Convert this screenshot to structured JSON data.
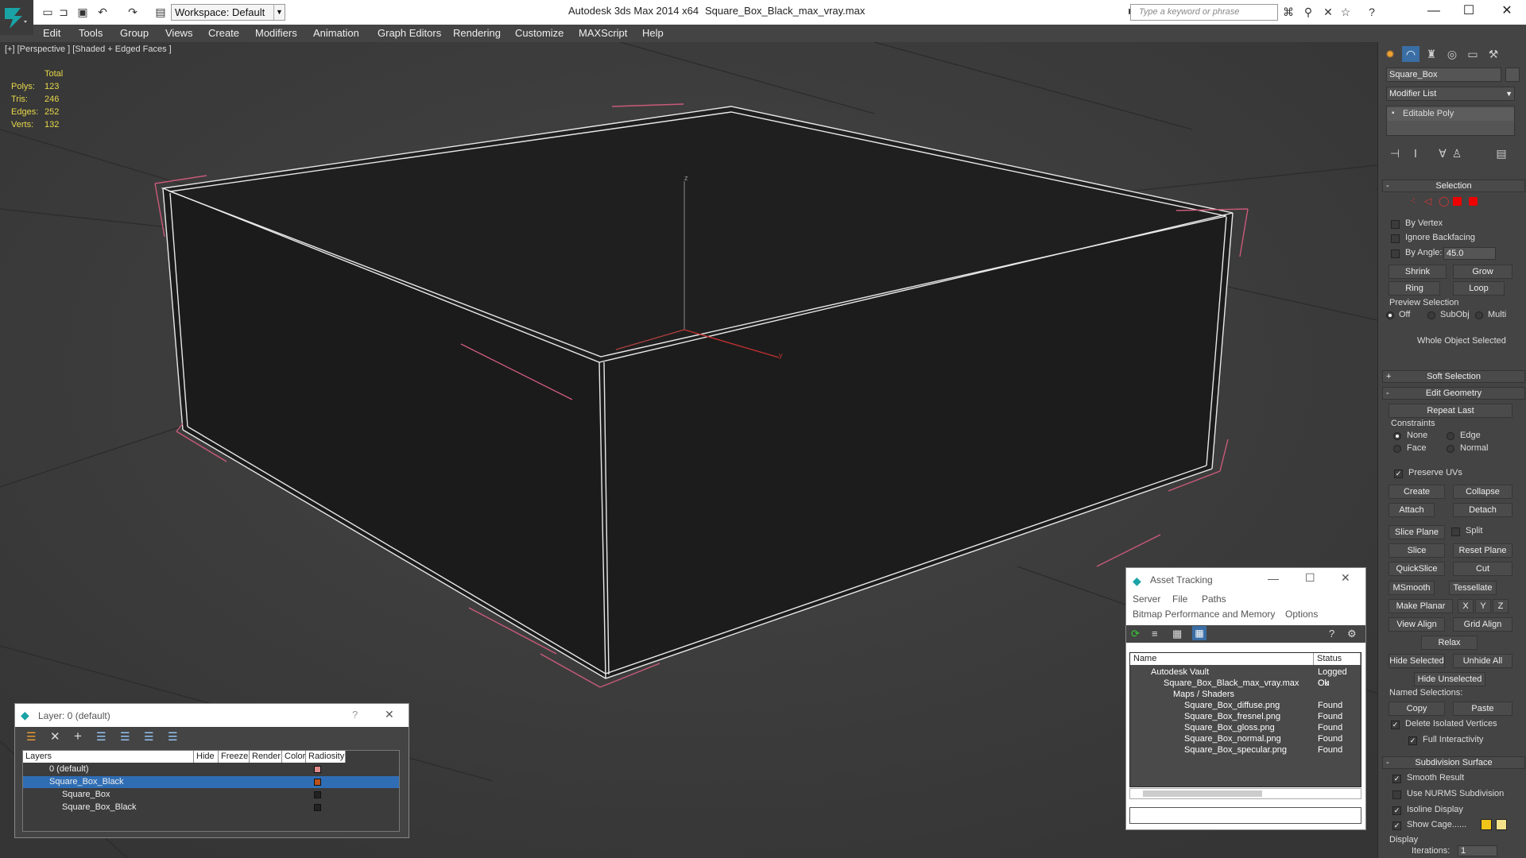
{
  "titlebar": {
    "workspace": "Workspace: Default",
    "app_title": "Autodesk 3ds Max  2014 x64",
    "file_title": "Square_Box_Black_max_vray.max",
    "search_placeholder": "Type a keyword or phrase"
  },
  "menu": [
    "Edit",
    "Tools",
    "Group",
    "Views",
    "Create",
    "Modifiers",
    "Animation",
    "Graph Editors",
    "Rendering",
    "Customize",
    "MAXScript",
    "Help"
  ],
  "viewport": {
    "label": "[+] [Perspective ] [Shaded + Edged Faces ]",
    "stats": {
      "header": "Total",
      "polys_label": "Polys:",
      "polys": "123",
      "tris_label": "Tris:",
      "tris": "246",
      "edges_label": "Edges:",
      "edges": "252",
      "verts_label": "Verts:",
      "verts": "132"
    },
    "axis_z": "z",
    "axis_y": "y"
  },
  "cmdpanel": {
    "object_name": "Square_Box",
    "modifier_list": "Modifier List",
    "stack_item": "Editable Poly",
    "selection": {
      "title": "Selection",
      "by_vertex": "By Vertex",
      "ignore_backfacing": "Ignore Backfacing",
      "by_angle": "By Angle:",
      "angle_value": "45.0",
      "shrink": "Shrink",
      "grow": "Grow",
      "ring": "Ring",
      "loop": "Loop",
      "preview_selection": "Preview Selection",
      "off": "Off",
      "subobj": "SubObj",
      "multi": "Multi",
      "status": "Whole Object Selected"
    },
    "soft_selection": "Soft Selection",
    "edit_geometry": {
      "title": "Edit Geometry",
      "repeat_last": "Repeat Last",
      "constraints": "Constraints",
      "none": "None",
      "edge": "Edge",
      "face": "Face",
      "normal": "Normal",
      "preserve_uvs": "Preserve UVs",
      "create": "Create",
      "collapse": "Collapse",
      "attach": "Attach",
      "detach": "Detach",
      "slice_plane": "Slice Plane",
      "split": "Split",
      "slice": "Slice",
      "reset_plane": "Reset Plane",
      "quickslice": "QuickSlice",
      "cut": "Cut",
      "msmooth": "MSmooth",
      "tessellate": "Tessellate",
      "make_planar": "Make Planar",
      "x": "X",
      "y": "Y",
      "z": "Z",
      "view_align": "View Align",
      "grid_align": "Grid Align",
      "relax": "Relax",
      "hide_selected": "Hide Selected",
      "unhide_all": "Unhide All",
      "hide_unselected": "Hide Unselected",
      "named_selections": "Named Selections:",
      "copy": "Copy",
      "paste": "Paste",
      "delete_isolated": "Delete Isolated Vertices",
      "full_interactivity": "Full Interactivity"
    },
    "subdivision": {
      "title": "Subdivision Surface",
      "smooth_result": "Smooth Result",
      "use_nurms": "Use NURMS Subdivision",
      "isoline_display": "Isoline Display",
      "show_cage": "Show Cage......",
      "display": "Display",
      "iterations": "Iterations:",
      "iterations_value": "1"
    },
    "colors": {
      "cage1": "#f0c419",
      "cage2": "#f2e08a"
    }
  },
  "asset_tracking": {
    "title": "Asset Tracking",
    "menu1": [
      "Server",
      "File",
      "Paths"
    ],
    "menu2": [
      "Bitmap Performance and Memory",
      "Options"
    ],
    "col_name": "Name",
    "col_status": "Status",
    "rows": [
      {
        "name": "Autodesk Vault",
        "status": "Logged Ou"
      },
      {
        "name": "Square_Box_Black_max_vray.max",
        "status": "Ok"
      },
      {
        "name": "Maps / Shaders",
        "status": ""
      },
      {
        "name": "Square_Box_diffuse.png",
        "status": "Found"
      },
      {
        "name": "Square_Box_fresnel.png",
        "status": "Found"
      },
      {
        "name": "Square_Box_gloss.png",
        "status": "Found"
      },
      {
        "name": "Square_Box_normal.png",
        "status": "Found"
      },
      {
        "name": "Square_Box_specular.png",
        "status": "Found"
      }
    ]
  },
  "layer_dialog": {
    "title": "Layer: 0 (default)",
    "help": "?",
    "columns": [
      "Layers",
      "Hide",
      "Freeze",
      "Render",
      "Color",
      "Radiosity"
    ],
    "rows": [
      {
        "name": "0 (default)",
        "color": "#e08a8a"
      },
      {
        "name": "Square_Box_Black",
        "color": "#b8501a"
      },
      {
        "name": "Square_Box",
        "color": "#222222"
      },
      {
        "name": "Square_Box_Black",
        "color": "#222222"
      }
    ]
  }
}
